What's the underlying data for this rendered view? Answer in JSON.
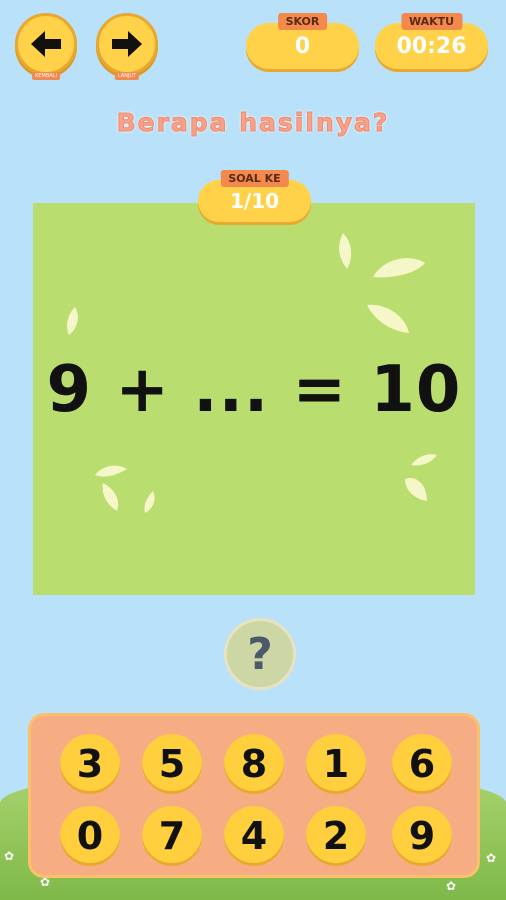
{
  "nav": {
    "back_label": "KEMBALI",
    "next_label": "LANJUT"
  },
  "score": {
    "label": "SKOR",
    "value": "0"
  },
  "timer": {
    "label": "WAKTU",
    "value": "00:26"
  },
  "prompt": "Berapa hasilnya?",
  "question_counter": {
    "label": "SOAL KE",
    "value": "1/10"
  },
  "equation": "9 + ... = 10",
  "hint": {
    "symbol": "?"
  },
  "keypad": {
    "row1": [
      "3",
      "5",
      "8",
      "1",
      "6"
    ],
    "row2": [
      "0",
      "7",
      "4",
      "2",
      "9"
    ]
  },
  "colors": {
    "sky": "#b9e1f9",
    "card": "#b9dd6f",
    "button": "#ffd24a",
    "tag": "#f3894d",
    "pad": "#f7ad84",
    "title": "#f7a28a"
  },
  "icons": [
    "arrow-left-icon",
    "arrow-right-icon",
    "question-mark-icon"
  ]
}
